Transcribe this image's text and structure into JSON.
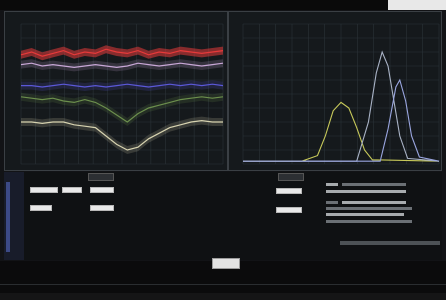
{
  "panels": {
    "left": {
      "title": "",
      "series": [
        {
          "name": "",
          "color": "#e63a3a",
          "values": [
            0.78,
            0.8,
            0.77,
            0.79,
            0.81,
            0.78,
            0.8,
            0.79,
            0.82,
            0.8,
            0.79,
            0.81,
            0.78,
            0.8,
            0.79,
            0.81,
            0.8,
            0.79,
            0.8,
            0.81
          ]
        },
        {
          "name": "",
          "color": "#c8a7d6",
          "values": [
            0.71,
            0.72,
            0.7,
            0.71,
            0.7,
            0.69,
            0.7,
            0.71,
            0.7,
            0.69,
            0.7,
            0.72,
            0.71,
            0.7,
            0.71,
            0.72,
            0.71,
            0.7,
            0.71,
            0.72
          ]
        },
        {
          "name": "",
          "color": "#5b58d8",
          "values": [
            0.56,
            0.56,
            0.55,
            0.56,
            0.57,
            0.56,
            0.55,
            0.56,
            0.55,
            0.56,
            0.57,
            0.56,
            0.55,
            0.56,
            0.57,
            0.56,
            0.57,
            0.56,
            0.57,
            0.56
          ]
        },
        {
          "name": "",
          "color": "#6c8f4d",
          "values": [
            0.48,
            0.47,
            0.46,
            0.47,
            0.45,
            0.44,
            0.46,
            0.44,
            0.4,
            0.35,
            0.3,
            0.36,
            0.4,
            0.42,
            0.44,
            0.46,
            0.47,
            0.48,
            0.47,
            0.48
          ]
        },
        {
          "name": "",
          "color": "#d7d3b0",
          "values": [
            0.3,
            0.3,
            0.29,
            0.3,
            0.3,
            0.28,
            0.27,
            0.26,
            0.2,
            0.14,
            0.1,
            0.12,
            0.18,
            0.22,
            0.26,
            0.28,
            0.3,
            0.31,
            0.3,
            0.3
          ]
        }
      ]
    },
    "right": {
      "title": "",
      "series": [
        {
          "name": "",
          "color": "#c7c95a",
          "x": [
            0.0,
            0.3,
            0.38,
            0.42,
            0.46,
            0.5,
            0.54,
            0.58,
            0.62,
            0.66,
            1.0
          ],
          "y": [
            0.02,
            0.02,
            0.06,
            0.2,
            0.38,
            0.44,
            0.4,
            0.26,
            0.1,
            0.03,
            0.02
          ]
        },
        {
          "name": "",
          "color": "#a9b3c6",
          "x": [
            0.0,
            0.58,
            0.64,
            0.68,
            0.71,
            0.74,
            0.77,
            0.8,
            0.84,
            1.0
          ],
          "y": [
            0.02,
            0.02,
            0.3,
            0.65,
            0.8,
            0.7,
            0.45,
            0.2,
            0.04,
            0.02
          ]
        },
        {
          "name": "",
          "color": "#9aa6e0",
          "x": [
            0.0,
            0.7,
            0.74,
            0.78,
            0.8,
            0.83,
            0.86,
            0.9,
            1.0
          ],
          "y": [
            0.02,
            0.02,
            0.25,
            0.55,
            0.6,
            0.45,
            0.2,
            0.05,
            0.02
          ]
        }
      ]
    }
  },
  "lower": {
    "hdr_left": "",
    "hdr_right": "",
    "fields_left": [
      "",
      "",
      ""
    ],
    "fields_left2": [
      "",
      ""
    ],
    "fields_right": [
      "",
      ""
    ]
  },
  "footer": {
    "ok_label": ""
  }
}
